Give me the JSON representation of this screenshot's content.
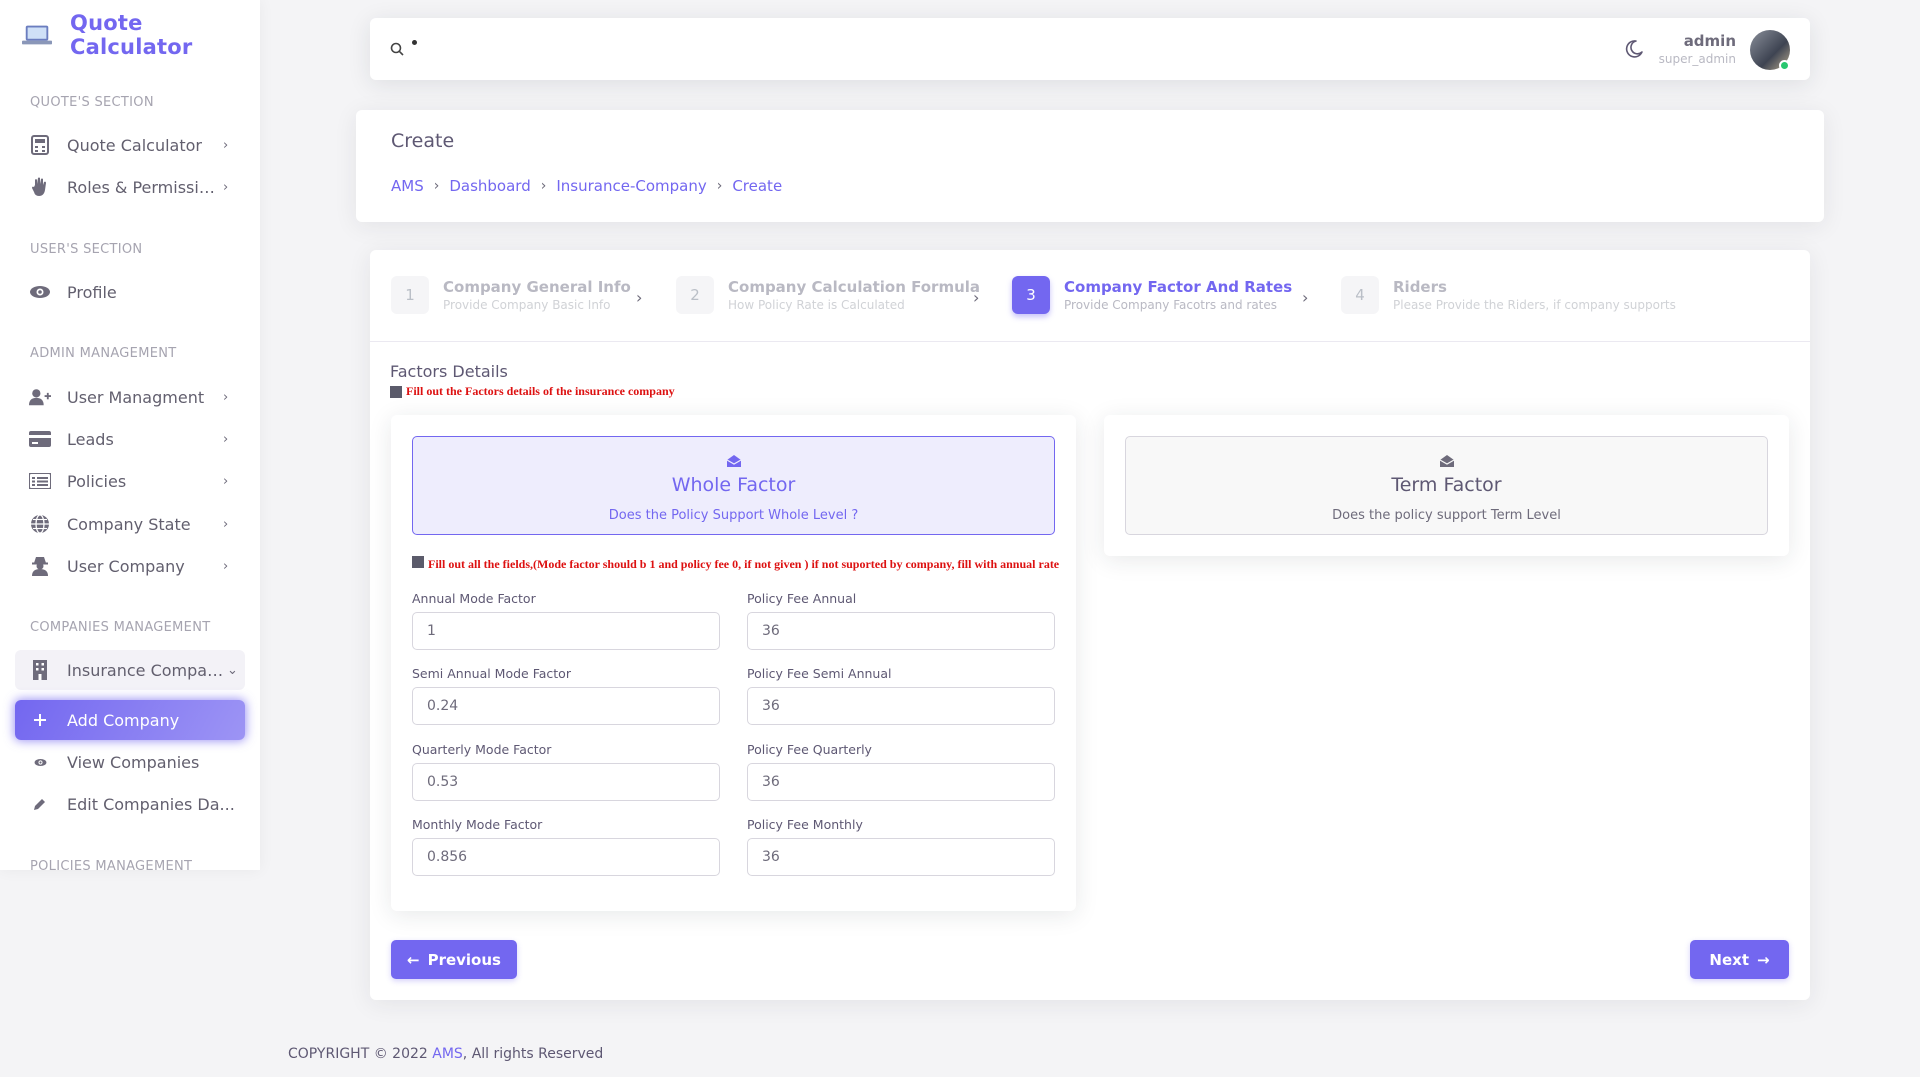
{
  "app": {
    "title": "Quote Calculator"
  },
  "sidebar": {
    "sections": [
      "QUOTE'S SECTION",
      "USER'S SECTION",
      "ADMIN MANAGEMENT",
      "COMPANIES MANAGEMENT",
      "POLICIES MANAGEMENT"
    ],
    "items": [
      {
        "label": "Quote Calculator",
        "icon": "calculator-icon"
      },
      {
        "label": "Roles & Permissions",
        "icon": "hand-icon"
      },
      {
        "label": "Profile",
        "icon": "eye-icon"
      },
      {
        "label": "User Managment",
        "icon": "user-plus-icon"
      },
      {
        "label": "Leads",
        "icon": "card-icon"
      },
      {
        "label": "Policies",
        "icon": "list-icon"
      },
      {
        "label": "Company State",
        "icon": "globe-icon"
      },
      {
        "label": "User Company",
        "icon": "user-secret-icon"
      },
      {
        "label": "Insurance Compani...",
        "icon": "building-icon"
      },
      {
        "label": "Add Company",
        "icon": "plus-icon"
      },
      {
        "label": "View Companies",
        "icon": "eye-icon"
      },
      {
        "label": "Edit Companies Da...",
        "icon": "pencil-icon"
      }
    ]
  },
  "topbar": {
    "username": "admin",
    "role": "super_admin"
  },
  "header": {
    "title": "Create",
    "breadcrumbs": [
      "AMS",
      "Dashboard",
      "Insurance-Company",
      "Create"
    ]
  },
  "steps": [
    {
      "num": "1",
      "title": "Company General Info",
      "subtitle": "Provide Company Basic Info"
    },
    {
      "num": "2",
      "title": "Company Calculation Formula",
      "subtitle": "How Policy Rate is Calculated"
    },
    {
      "num": "3",
      "title": "Company Factor And Rates",
      "subtitle": "Provide Company Facotrs and rates"
    },
    {
      "num": "4",
      "title": "Riders",
      "subtitle": "Please Provide the Riders, if company supports"
    }
  ],
  "factors": {
    "title": "Factors Details",
    "note": "Fill out the Factors details of the insurance company",
    "whole": {
      "title": "Whole Factor",
      "subtitle": "Does the Policy Support Whole Level ?"
    },
    "term": {
      "title": "Term Factor",
      "subtitle": "Does the policy support Term Level"
    },
    "fields_note": "Fill out all the fields,(Mode factor should b 1 and policy fee 0, if not given ) if not suported by company, fill with annual rate",
    "fields": [
      {
        "label": "Annual Mode Factor",
        "value": "1"
      },
      {
        "label": "Policy Fee Annual",
        "value": "36"
      },
      {
        "label": "Semi Annual Mode Factor",
        "value": "0.24"
      },
      {
        "label": "Policy Fee Semi Annual",
        "value": "36"
      },
      {
        "label": "Quarterly Mode Factor",
        "value": "0.53"
      },
      {
        "label": "Policy Fee Quarterly",
        "value": "36"
      },
      {
        "label": "Monthly Mode Factor",
        "value": "0.856"
      },
      {
        "label": "Policy Fee Monthly",
        "value": "36"
      }
    ]
  },
  "buttons": {
    "previous": "Previous",
    "next": "Next"
  },
  "footer": {
    "prefix": "COPYRIGHT © 2022 ",
    "brand": "AMS",
    "suffix": ", All rights Reserved"
  },
  "colors": {
    "primary": "#7367f0",
    "note_red": "#dd1111",
    "online": "#28c76f"
  }
}
